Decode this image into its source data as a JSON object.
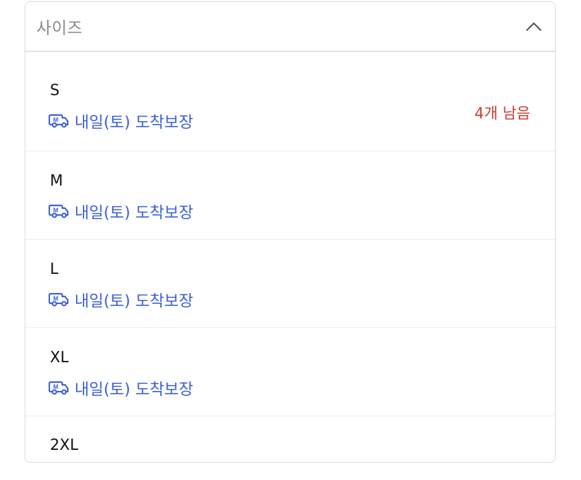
{
  "select": {
    "placeholder": "사이즈",
    "icon": "chevron-up-icon"
  },
  "colors": {
    "delivery": "#3a5fd9",
    "stock_warning": "#d23a34",
    "text": "#111111",
    "placeholder": "#8a8a8a"
  },
  "options": [
    {
      "size": "S",
      "delivery": "내일(토) 도착보장",
      "stock": "4개 남음"
    },
    {
      "size": "M",
      "delivery": "내일(토) 도착보장"
    },
    {
      "size": "L",
      "delivery": "내일(토) 도착보장"
    },
    {
      "size": "XL",
      "delivery": "내일(토) 도착보장"
    },
    {
      "size": "2XL"
    }
  ],
  "delivery_icon": "truck-icon"
}
